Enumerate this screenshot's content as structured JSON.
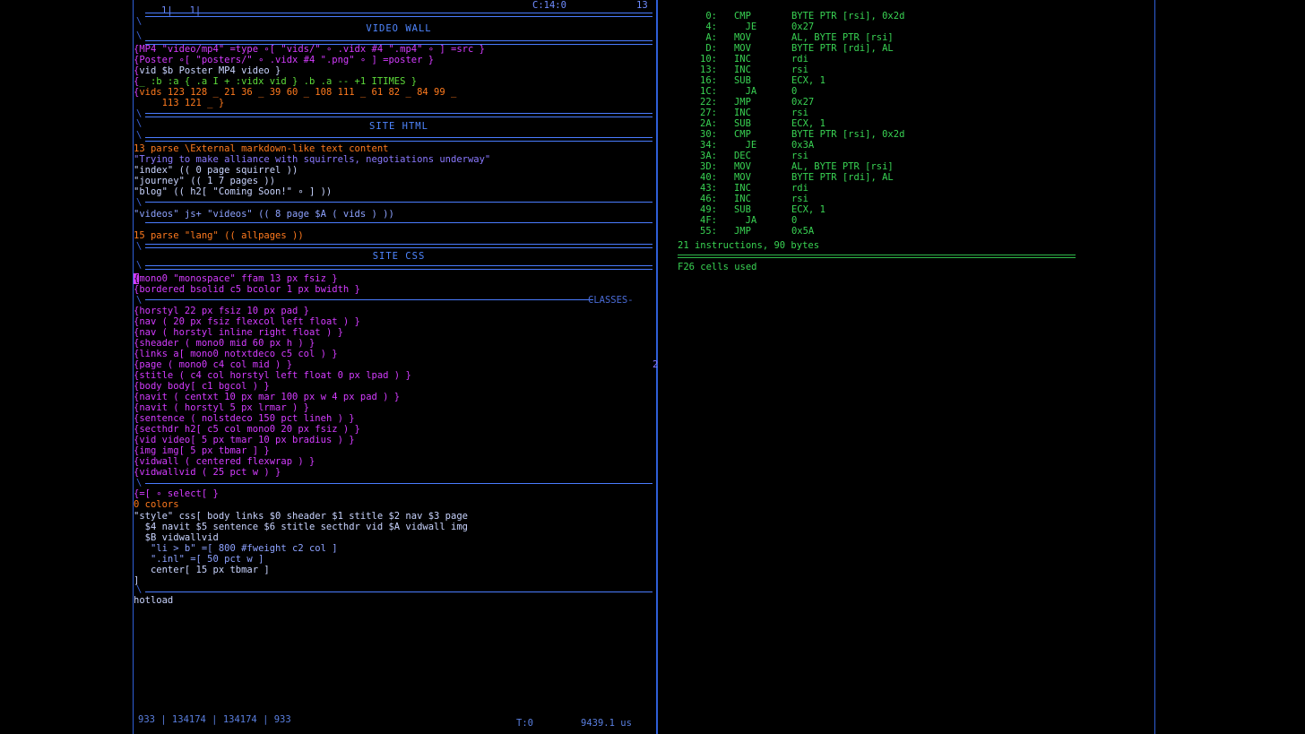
{
  "editor": {
    "top_left": "1|   1|",
    "top_pos": "C:14:0",
    "top_right": "13",
    "sections": {
      "video_wall": "VIDEO WALL",
      "site_html": "SITE HTML",
      "site_css": "SITE CSS",
      "classes_label": "CLASSES"
    },
    "video_lines": [
      "MP4 \"video/mp4\" =type ∘[ \"vids/\" ∘ .vidx #4 \".mp4\" ∘ ] =src }",
      "Poster ∘[ \"posters/\" ∘ .vidx #4 \".png\" ∘ ] =poster }",
      "vid $b Poster MP4 video }",
      "_ :b :a { .a I + :vidx vid } .b .a -- +1 ITIMES }",
      "vids 123 128 _ 21 36 _ 39 60 _ 108 111 _ 61 82 _ 84 99 _",
      "     113 121 _ }"
    ],
    "html_lines": [
      "13 parse \\External markdown-like text content",
      "\"Trying to make alliance with squirrels, negotiations underway\"",
      "\"index\" (( 0 page squirrel ))",
      "\"journey\" (( 1 7 pages ))",
      "\"blog\" (( h2[ \"Coming Soon!\" ∘ ] ))",
      "\"videos\" js+ \"videos\" (( 8 page $A ( vids ) ))",
      "15 parse \"lang\" (( allpages ))"
    ],
    "css_lines": [
      "mono0 \"monospace\" ffam 13 px fsiz }",
      "bordered bsolid c5 bcolor 1 px bwidth }",
      "horstyl 22 px fsiz 10 px pad }",
      "nav ( 20 px fsiz flexcol left float ) }",
      "nav ( horstyl inline right float ) }",
      "sheader ( mono0 mid 60 px h ) }",
      "links a[ mono0 notxtdeco c5 col ) }",
      "page ( mono0 c4 col mid ) }",
      "stitle ( c4 col horstyl left float 0 px lpad ) }",
      "body body[ c1 bgcol ) }",
      "navit ( centxt 10 px mar 100 px w 4 px pad ) }",
      "navit ( horstyl 5 px lrmar ) }",
      "sentence ( nolstdeco 150 pct lineh ) }",
      "secthdr h2[ c5 col mono0 20 px fsiz ) }",
      "vid video[ 5 px tmar 10 px bradius ) }",
      "img img[ 5 px tbmar ] }",
      "vidwall ( centered flexwrap ) }",
      "vidwallvid ( 25 pct w ) }"
    ],
    "style_lines": [
      "=[ ∘ select[ }",
      "0 colors",
      "\"style\" css[ body links $0 sheader $1 stitle $2 nav $3 page",
      "  $4 navit $5 sentence $6 stitle secthdr vid $A vidwall img",
      "  $B vidwallvid",
      "   \"li > b\" =[ 800 #fweight c2 col ]",
      "   \".inl\" =[ 50 pct w ]",
      "   center[ 15 px tbmar ]",
      "]"
    ],
    "hotload": "hotload",
    "gutter_mark": "2",
    "status": {
      "counts": "933 | 134174 | 134174 | 933",
      "t": "T:0",
      "time": "9439.1 us"
    }
  },
  "asm": {
    "rows": [
      {
        "addr": "0:",
        "mn": "CMP",
        "op": "BYTE PTR [rsi], 0x2d"
      },
      {
        "addr": "4:",
        "mn": "  JE",
        "op": "0x27"
      },
      {
        "addr": "A:",
        "mn": "MOV",
        "op": "AL, BYTE PTR [rsi]"
      },
      {
        "addr": "D:",
        "mn": "MOV",
        "op": "BYTE PTR [rdi], AL"
      },
      {
        "addr": "10:",
        "mn": "INC",
        "op": "rdi"
      },
      {
        "addr": "13:",
        "mn": "INC",
        "op": "rsi"
      },
      {
        "addr": "16:",
        "mn": "SUB",
        "op": "ECX, 1"
      },
      {
        "addr": "1C:",
        "mn": "  JA",
        "op": "0"
      },
      {
        "addr": "22:",
        "mn": "JMP",
        "op": "0x27"
      },
      {
        "addr": "27:",
        "mn": "INC",
        "op": "rsi"
      },
      {
        "addr": "2A:",
        "mn": "SUB",
        "op": "ECX, 1"
      },
      {
        "addr": "30:",
        "mn": "CMP",
        "op": "BYTE PTR [rsi], 0x2d"
      },
      {
        "addr": "34:",
        "mn": "  JE",
        "op": "0x3A"
      },
      {
        "addr": "3A:",
        "mn": "DEC",
        "op": "rsi"
      },
      {
        "addr": "3D:",
        "mn": "MOV",
        "op": "AL, BYTE PTR [rsi]"
      },
      {
        "addr": "40:",
        "mn": "MOV",
        "op": "BYTE PTR [rdi], AL"
      },
      {
        "addr": "43:",
        "mn": "INC",
        "op": "rdi"
      },
      {
        "addr": "46:",
        "mn": "INC",
        "op": "rsi"
      },
      {
        "addr": "49:",
        "mn": "SUB",
        "op": "ECX, 1"
      },
      {
        "addr": "4F:",
        "mn": "  JA",
        "op": "0"
      },
      {
        "addr": "55:",
        "mn": "JMP",
        "op": "0x5A"
      }
    ],
    "summary": "21 instructions, 90 bytes",
    "cells": "F26 cells used"
  },
  "colors": {
    "keyword": "#d43cff",
    "number": "#ff7a1e",
    "text": "#8da2ff",
    "asm": "#39d353",
    "frame": "#2f5fd8"
  }
}
